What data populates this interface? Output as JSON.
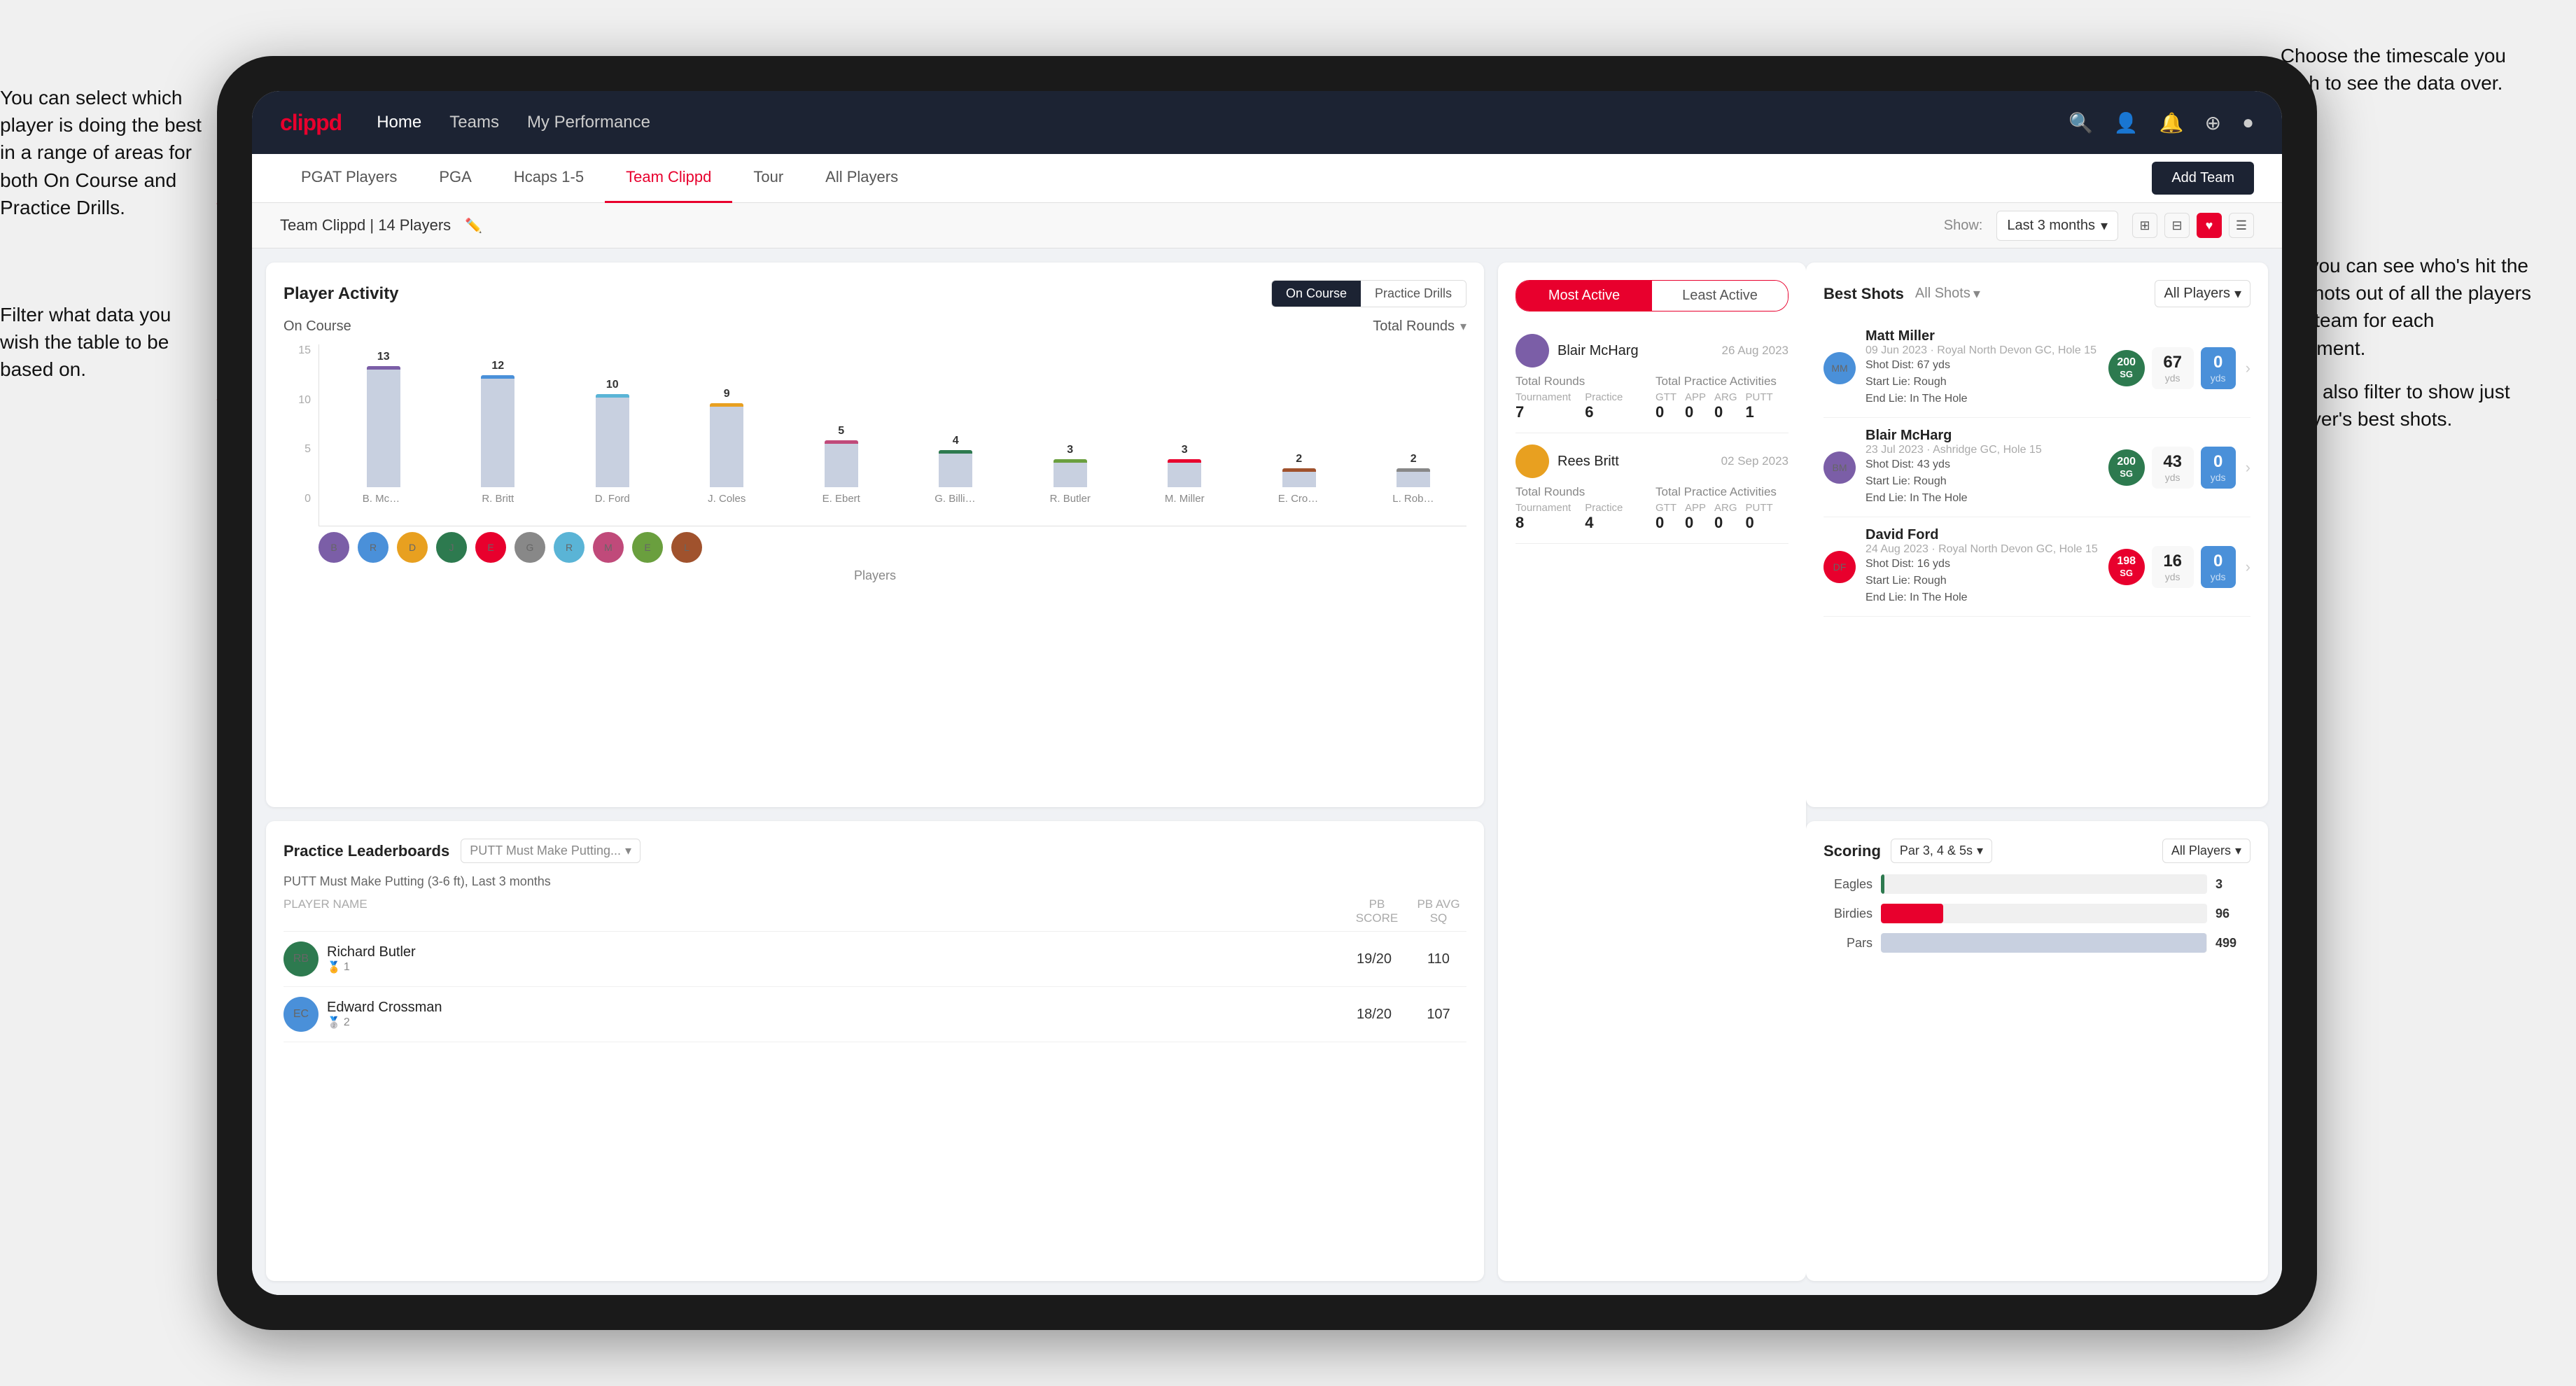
{
  "annotations": {
    "top_right": "Choose the timescale you\nwish to see the data over.",
    "left_top": "You can select which player is\ndoing the best in a range of\nareas for both On Course and\nPractice Drills.",
    "left_mid": "Filter what data you wish the\ntable to be based on.",
    "right_mid": "Here you can see who's hit\nthe best shots out of all the\nplayers in the team for\neach department.",
    "right_bottom": "You can also filter to show\njust one player's best shots."
  },
  "nav": {
    "logo": "clippd",
    "links": [
      "Home",
      "Teams",
      "My Performance"
    ],
    "icons": [
      "search",
      "person",
      "bell",
      "add-circle",
      "user-circle"
    ]
  },
  "sub_nav": {
    "tabs": [
      "PGAT Players",
      "PGA",
      "Hcaps 1-5",
      "Team Clippd",
      "Tour",
      "All Players"
    ],
    "active": "Team Clippd",
    "add_team_btn": "Add Team"
  },
  "team_header": {
    "title": "Team Clippd | 14 Players",
    "show_label": "Show:",
    "timescale": "Last 3 months",
    "view_modes": [
      "grid-4",
      "grid-3",
      "heart",
      "list"
    ]
  },
  "player_activity": {
    "title": "Player Activity",
    "toggle_options": [
      "On Course",
      "Practice Drills"
    ],
    "active_toggle": "On Course",
    "section_label": "On Course",
    "chart_dropdown": "Total Rounds",
    "x_axis_label": "Players",
    "y_labels": [
      "15",
      "10",
      "5",
      "0"
    ],
    "bars": [
      {
        "name": "B. McHarg",
        "value": 13,
        "height_pct": 87
      },
      {
        "name": "R. Britt",
        "value": 12,
        "height_pct": 80
      },
      {
        "name": "D. Ford",
        "value": 10,
        "height_pct": 67
      },
      {
        "name": "J. Coles",
        "value": 9,
        "height_pct": 60
      },
      {
        "name": "E. Ebert",
        "value": 5,
        "height_pct": 33
      },
      {
        "name": "G. Billingham",
        "value": 4,
        "height_pct": 27
      },
      {
        "name": "R. Butler",
        "value": 3,
        "height_pct": 20
      },
      {
        "name": "M. Miller",
        "value": 3,
        "height_pct": 20
      },
      {
        "name": "E. Crossman",
        "value": 2,
        "height_pct": 13
      },
      {
        "name": "L. Robertson",
        "value": 2,
        "height_pct": 13
      }
    ]
  },
  "best_shots": {
    "title": "Best Shots",
    "tabs": [
      "All Shots",
      "All Players"
    ],
    "players": [
      {
        "name": "Matt Miller",
        "date": "09 Jun 2023",
        "course": "Royal North Devon GC",
        "hole": "Hole 15",
        "badge_text": "200",
        "badge_sub": "SG",
        "badge_color": "green",
        "shot_dist": "Shot Dist: 67 yds",
        "start_lie": "Start Lie: Rough",
        "end_lie": "End Lie: In The Hole",
        "stat1_val": "67",
        "stat1_unit": "yds",
        "stat2_val": "0",
        "stat2_unit": "yds"
      },
      {
        "name": "Blair McHarg",
        "date": "23 Jul 2023",
        "course": "Ashridge GC",
        "hole": "Hole 15",
        "badge_text": "200",
        "badge_sub": "SG",
        "badge_color": "green",
        "shot_dist": "Shot Dist: 43 yds",
        "start_lie": "Start Lie: Rough",
        "end_lie": "End Lie: In The Hole",
        "stat1_val": "43",
        "stat1_unit": "yds",
        "stat2_val": "0",
        "stat2_unit": "yds"
      },
      {
        "name": "David Ford",
        "date": "24 Aug 2023",
        "course": "Royal North Devon GC",
        "hole": "Hole 15",
        "badge_text": "198",
        "badge_sub": "SG",
        "badge_color": "red",
        "shot_dist": "Shot Dist: 16 yds",
        "start_lie": "Start Lie: Rough",
        "end_lie": "End Lie: In The Hole",
        "stat1_val": "16",
        "stat1_unit": "yds",
        "stat2_val": "0",
        "stat2_unit": "yds"
      }
    ]
  },
  "practice_leaderboards": {
    "title": "Practice Leaderboards",
    "drill": "PUTT Must Make Putting...",
    "description": "PUTT Must Make Putting (3-6 ft), Last 3 months",
    "columns": [
      "PLAYER NAME",
      "PB SCORE",
      "PB AVG SQ"
    ],
    "players": [
      {
        "name": "Richard Butler",
        "rank": 1,
        "medal": "gold",
        "pb_score": "19/20",
        "pb_avg": "110"
      },
      {
        "name": "Edward Crossman",
        "rank": 2,
        "medal": "silver",
        "pb_score": "18/20",
        "pb_avg": "107"
      }
    ]
  },
  "most_active": {
    "tabs": [
      "Most Active",
      "Least Active"
    ],
    "active_tab": "Most Active",
    "players": [
      {
        "name": "Blair McHarg",
        "date": "26 Aug 2023",
        "total_rounds_label": "Total Rounds",
        "tournament": "7",
        "practice": "6",
        "total_practice_label": "Total Practice Activities",
        "gtt": "0",
        "app": "0",
        "arg": "0",
        "putt": "1"
      },
      {
        "name": "Rees Britt",
        "date": "02 Sep 2023",
        "total_rounds_label": "Total Rounds",
        "tournament": "8",
        "practice": "4",
        "total_practice_label": "Total Practice Activities",
        "gtt": "0",
        "app": "0",
        "arg": "0",
        "putt": "0"
      }
    ]
  },
  "scoring": {
    "title": "Scoring",
    "filter": "Par 3, 4 & 5s",
    "player_filter": "All Players",
    "bars": [
      {
        "label": "Eagles",
        "value": 3,
        "max": 500,
        "color": "#2d7a4f"
      },
      {
        "label": "Birdies",
        "value": 96,
        "max": 500,
        "color": "#e8002d"
      },
      {
        "label": "Pars",
        "value": 499,
        "max": 500,
        "color": "#c8d0e0"
      }
    ]
  }
}
